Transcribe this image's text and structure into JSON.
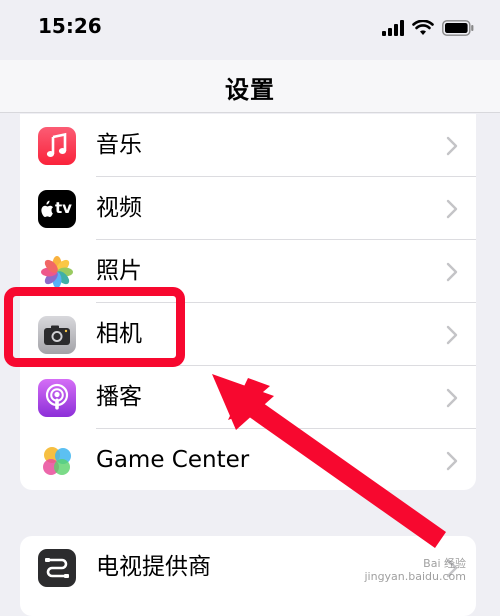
{
  "status_bar": {
    "time": "15:26"
  },
  "nav": {
    "title": "设置"
  },
  "groups": [
    {
      "items": [
        {
          "label": "音乐",
          "icon": "music-icon"
        },
        {
          "label": "视频",
          "icon": "apple-tv-icon",
          "icon_text": "tv"
        },
        {
          "label": "照片",
          "icon": "photos-icon"
        },
        {
          "label": "相机",
          "icon": "camera-icon"
        },
        {
          "label": "播客",
          "icon": "podcasts-icon"
        },
        {
          "label": "Game Center",
          "icon": "game-center-icon"
        }
      ]
    },
    {
      "items": [
        {
          "label": "电视提供商",
          "icon": "tv-provider-icon"
        }
      ]
    }
  ],
  "watermark": {
    "line1": "Bai 经验",
    "line2": "jingyan.baidu.com"
  },
  "colors": {
    "highlight": "#f7082f",
    "background": "#efeff4"
  }
}
